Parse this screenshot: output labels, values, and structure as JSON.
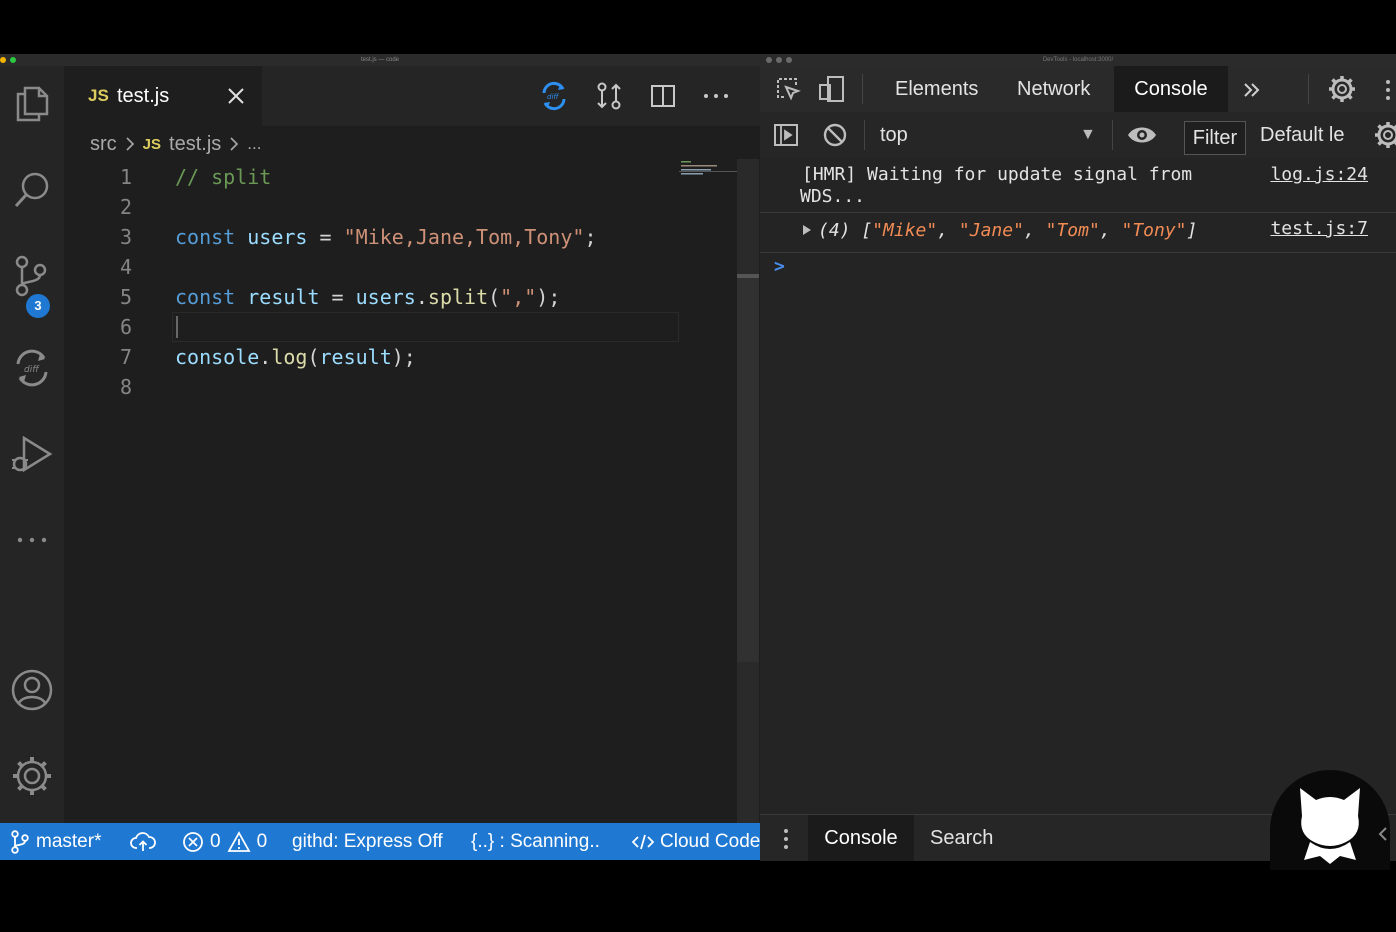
{
  "editor": {
    "window_title": "test.js — code",
    "tab": {
      "icon": "JS",
      "label": "test.js"
    },
    "breadcrumb": {
      "folder": "src",
      "icon": "JS",
      "file": "test.js",
      "more": "..."
    },
    "line_numbers": [
      "1",
      "2",
      "3",
      "4",
      "5",
      "6",
      "7",
      "8"
    ],
    "code": {
      "l1": {
        "comment": "// split"
      },
      "l3": {
        "kw": "const",
        "name": "users",
        "op": " = ",
        "str": "\"Mike,Jane,Tom,Tony\"",
        "end": ";"
      },
      "l5": {
        "kw": "const",
        "name": "result",
        "op": " = ",
        "obj": "users",
        "dot": ".",
        "fn": "split",
        "open": "(",
        "str": "\",\"",
        "close": ");"
      },
      "l7": {
        "obj": "console",
        "dot": ".",
        "fn": "log",
        "open": "(",
        "arg": "result",
        "close": ");"
      }
    },
    "source_control_badge": "3",
    "status": {
      "branch": "master*",
      "errors": "0",
      "warnings": "0",
      "githd": "githd: Express Off",
      "scanning": "{..} : Scanning..",
      "cloud": "Cloud Code"
    },
    "accent": "#1f78d1"
  },
  "devtools": {
    "window_title": "DevTools - localhost:3000/",
    "tabs": [
      "Elements",
      "Network",
      "Console"
    ],
    "active_tab": "Console",
    "context": "top",
    "filter_label": "Filter",
    "levels_label": "Default le",
    "messages": {
      "m1": {
        "line1": "[HMR] Waiting for update signal from",
        "line2": "WDS...",
        "source": "log.js:24"
      },
      "m2": {
        "prefix": "(4) [",
        "items": [
          "\"Mike\"",
          "\"Jane\"",
          "\"Tom\"",
          "\"Tony\""
        ],
        "sep": ", ",
        "suffix": "]",
        "source": "test.js:7"
      }
    },
    "prompt": ">",
    "drawer": {
      "console": "Console",
      "search": "Search"
    }
  }
}
